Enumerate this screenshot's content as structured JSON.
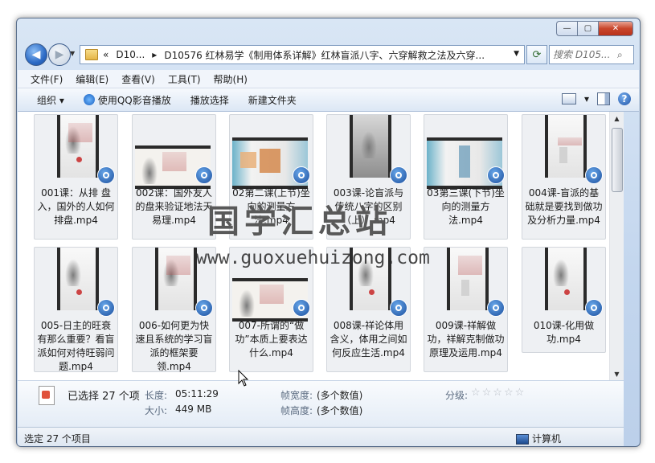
{
  "window": {
    "caption_buttons": {
      "minimize": "—",
      "maximize": "▢",
      "close": "✕"
    }
  },
  "nav": {
    "back": "◀",
    "forward": "▶",
    "dropdown": "▼"
  },
  "address": {
    "chevron": "«",
    "crumb1": "D10...",
    "sep": "▸",
    "path": "D10576 红林易学《制用体系详解》红林盲派八字、六穿解救之法及六穿...",
    "dropdown": "▼",
    "refresh": "⟳"
  },
  "search": {
    "placeholder": "搜索 D105...",
    "icon": "⌕"
  },
  "menu": [
    "文件(F)",
    "编辑(E)",
    "查看(V)",
    "工具(T)",
    "帮助(H)"
  ],
  "toolbar": {
    "organize": "组织 ▾",
    "play_qq": "使用QQ影音播放",
    "play_select": "播放选择",
    "new_folder": "新建文件夹",
    "view_drop": "▾",
    "help": "?"
  },
  "files": [
    {
      "name": "001课：从排 盘入，国外的人如何排盘.mp4",
      "thumb": "portrait"
    },
    {
      "name": "002课：国外友人的盘来验证地法天易理.mp4",
      "thumb": "landscape"
    },
    {
      "name": "02第二课(上节)坐向的测量方法.mp4",
      "thumb": "diagram"
    },
    {
      "name": "003课-论盲派与传统八字的区别（上）.mp4",
      "thumb": "portrait"
    },
    {
      "name": "03第三课(下节)坐向的测量方法.mp4",
      "thumb": "diagram"
    },
    {
      "name": "004课-盲派的基础就是要找到做功及分析力量.mp4",
      "thumb": "portrait"
    },
    {
      "name": "005-日主的旺衰有那么重要？看盲派如何对待旺弱问题.mp4",
      "thumb": "portrait"
    },
    {
      "name": "006-如何更为快速且系统的学习盲派的框架要领.mp4",
      "thumb": "portrait"
    },
    {
      "name": "007-所谓的“做功”本质上要表达什么.mp4",
      "thumb": "landscape"
    },
    {
      "name": "008课-祥论体用含义，体用之间如何反应生活.mp4",
      "thumb": "portrait"
    },
    {
      "name": "009课-祥解做功，祥解克制做功原理及运用.mp4",
      "thumb": "portrait"
    },
    {
      "name": "010课-化用做功.mp4",
      "thumb": "portrait"
    }
  ],
  "details": {
    "selected": "已选择 27 个项",
    "length_label": "长度:",
    "length_value": "05:11:29",
    "size_label": "大小:",
    "size_value": "449 MB",
    "width_label": "帧宽度:",
    "width_value": "(多个数值)",
    "height_label": "帧高度:",
    "height_value": "(多个数值)",
    "rating_label": "分级:",
    "rating_stars": "☆☆☆☆☆",
    "rating_value": 0
  },
  "statusbar": {
    "left": "选定 27 个项目",
    "right": "计算机"
  },
  "watermark": {
    "line1": "国学汇总站",
    "line2": "www.guoxuehuizong.com"
  },
  "scrollbar": {
    "up": "▲",
    "down": "▼"
  }
}
